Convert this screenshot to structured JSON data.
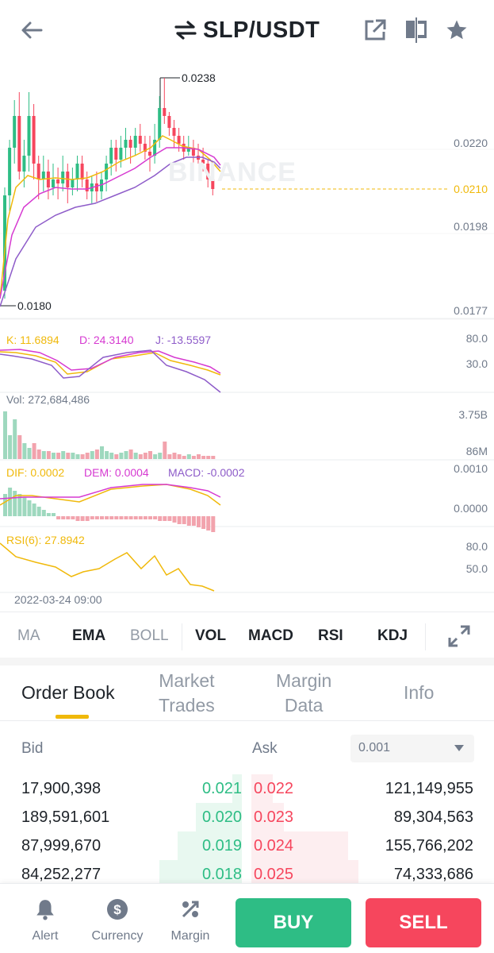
{
  "header": {
    "title": "SLP/USDT",
    "back_icon": "arrow-left-icon",
    "swap_icon": "swap-arrows-icon",
    "share_icon": "external-link-icon",
    "compare_icon": "split-view-icon",
    "favorite_icon": "star-icon"
  },
  "chart": {
    "watermark": "BINANCE",
    "price_axis": [
      "0.0220",
      "0.0210",
      "0.0198",
      "0.0177"
    ],
    "current_price_label": "0.0210",
    "high_label": "0.0238",
    "low_label": "0.0180",
    "kdj_legend": {
      "k": "K: 11.6894",
      "d": "D: 24.3140",
      "j": "J: -13.5597"
    },
    "kdj_axis": [
      "80.0",
      "30.0"
    ],
    "vol_legend": "Vol: 272,684,486",
    "vol_axis": [
      "3.75B",
      "86M"
    ],
    "macd_legend": {
      "dif": "DIF: 0.0002",
      "dem": "DEM: 0.0004",
      "macd": "MACD: -0.0002"
    },
    "macd_axis": [
      "0.0010",
      "0.0000"
    ],
    "rsi_legend": "RSI(6): 27.8942",
    "rsi_axis": [
      "80.0",
      "50.0"
    ],
    "timestamp": "2022-03-24 09:00",
    "colors": {
      "up": "#2ebd85",
      "down": "#f6465d",
      "yellow": "#f0b90b",
      "magenta": "#d63ad1",
      "purple": "#8e5cc9"
    }
  },
  "indicators": {
    "items": [
      "MA",
      "EMA",
      "BOLL",
      "VOL",
      "MACD",
      "RSI",
      "KDJ"
    ],
    "expand_icon": "expand-arrows-icon"
  },
  "tabs": {
    "order_book": "Order Book",
    "market_trades_1": "Market",
    "market_trades_2": "Trades",
    "margin_data_1": "Margin",
    "margin_data_2": "Data",
    "info": "Info"
  },
  "orderbook": {
    "bid_label": "Bid",
    "ask_label": "Ask",
    "precision": "0.001",
    "rows": [
      {
        "bid_qty": "17,900,398",
        "bid_price": "0.021",
        "ask_price": "0.022",
        "ask_qty": "121,149,955",
        "bid_depth": 0.1,
        "ask_depth": 0.2
      },
      {
        "bid_qty": "189,591,601",
        "bid_price": "0.020",
        "ask_price": "0.023",
        "ask_qty": "89,304,563",
        "bid_depth": 0.5,
        "ask_depth": 0.3
      },
      {
        "bid_qty": "87,999,670",
        "bid_price": "0.019",
        "ask_price": "0.024",
        "ask_qty": "155,766,202",
        "bid_depth": 0.7,
        "ask_depth": 0.9
      },
      {
        "bid_qty": "84,252,277",
        "bid_price": "0.018",
        "ask_price": "0.025",
        "ask_qty": "74,333,686",
        "bid_depth": 0.9,
        "ask_depth": 1.0
      }
    ]
  },
  "bottom_nav": {
    "alert": "Alert",
    "currency": "Currency",
    "margin": "Margin",
    "buy": "BUY",
    "sell": "SELL"
  }
}
